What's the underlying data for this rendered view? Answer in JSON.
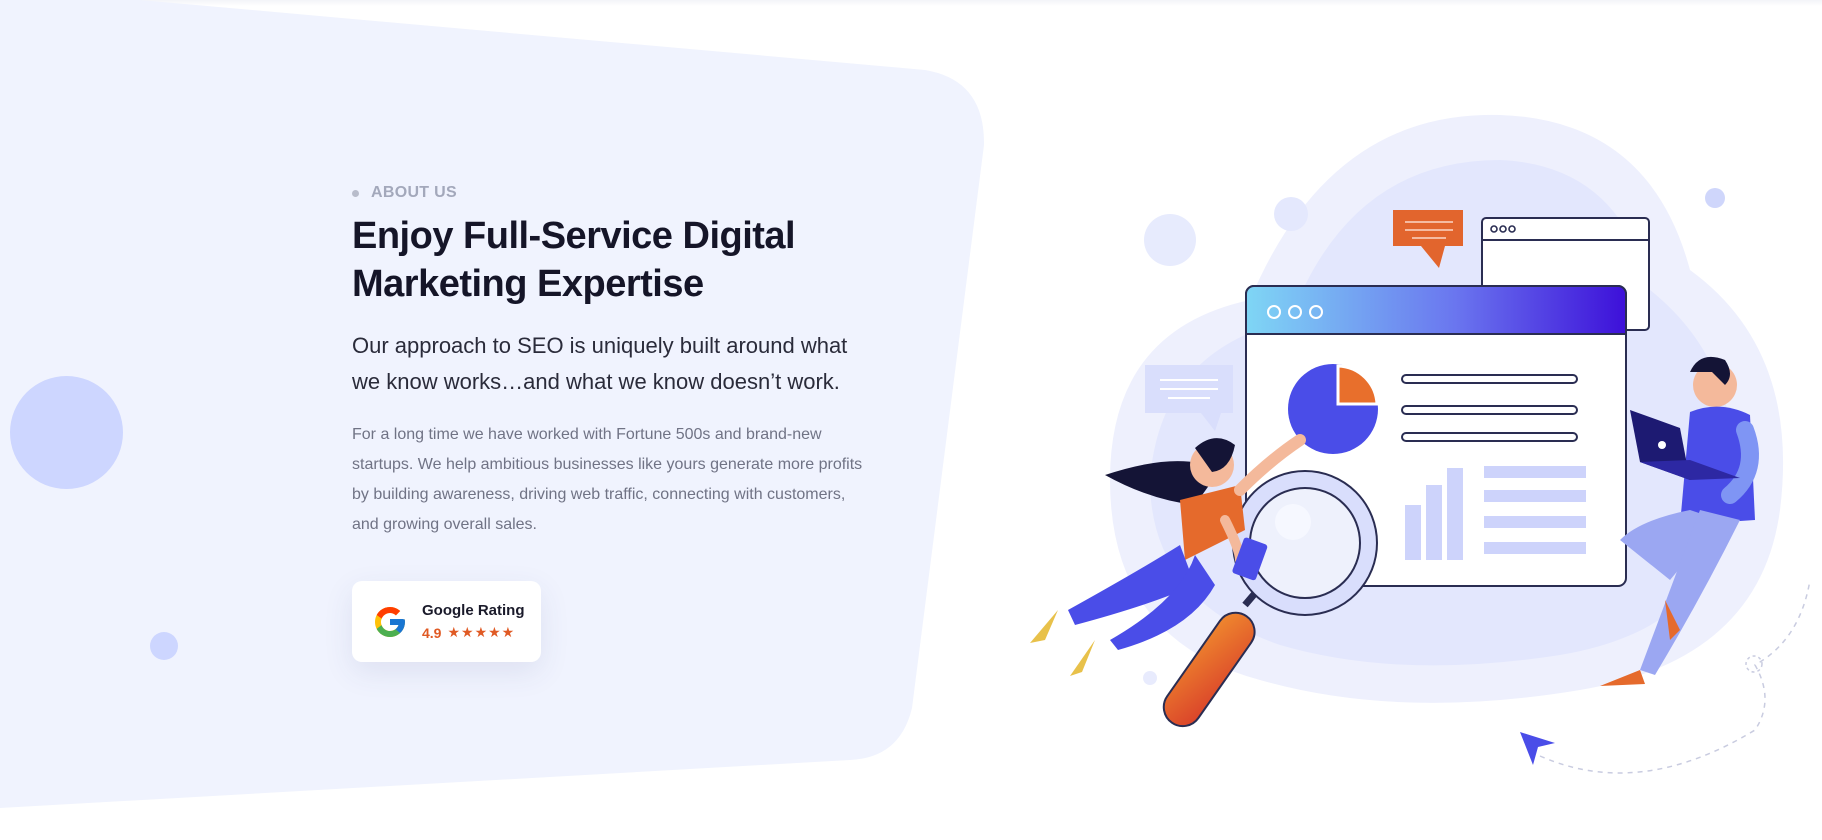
{
  "about_label": "ABOUT US",
  "heading": "Enjoy Full-Service Digital Marketing Expertise",
  "lead": "Our approach to SEO is uniquely built around what we know works…and what we know doesn’t work.",
  "body": "For a long time we have worked with Fortune 500s and brand-new startups. We help ambitious businesses like yours generate more profits by building awareness, driving web traffic, connecting with customers, and growing overall sales.",
  "rating_card": {
    "title": "Google Rating",
    "score": "4.9",
    "stars": "★★★★★",
    "star_count": 5
  },
  "colors": {
    "accent": "#e05a24",
    "primary": "#4a4de8",
    "heading": "#151528",
    "panel_bg": "#f0f3fe"
  },
  "icons": [
    "google-icon",
    "star-icon",
    "cursor-arrow-icon",
    "pie-chart-icon",
    "magnifier-icon",
    "chat-bubble-icon",
    "laptop-icon"
  ]
}
